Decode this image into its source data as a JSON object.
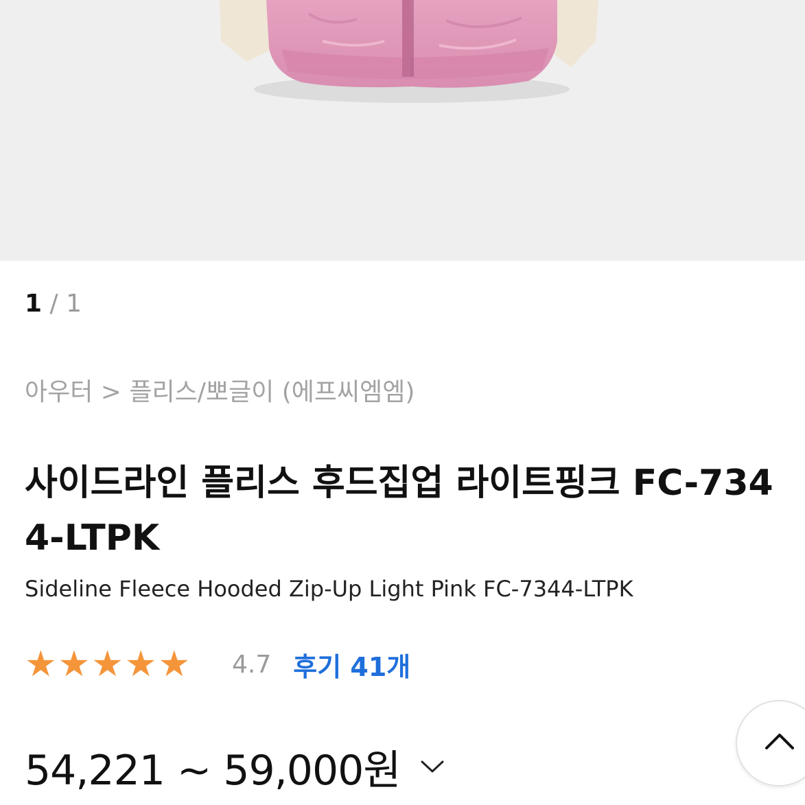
{
  "gallery": {
    "current": "1",
    "separator": "/",
    "total": "1"
  },
  "breadcrumb": "아우터 > 플리스/뽀글이 (에프씨엠엠)",
  "product": {
    "title_ko": "사이드라인 플리스 후드집업 라이트핑크 FC-7344-LTPK",
    "title_en": "Sideline Fleece Hooded Zip-Up Light Pink FC-7344-LTPK",
    "rating": "4.7",
    "rating_value": 4.7,
    "rating_max": 5,
    "reviews_link": "후기 41개",
    "price_range": "54,221 ~ 59,000원"
  },
  "icons": {
    "star": "star-icon",
    "price_toggle": "chevron-down-icon",
    "scroll_top": "chevron-up-icon"
  },
  "colors": {
    "star": "#f5953a",
    "link": "#1f6fdb",
    "hero_bg": "#efefef",
    "jacket": "#e8a9c4"
  }
}
